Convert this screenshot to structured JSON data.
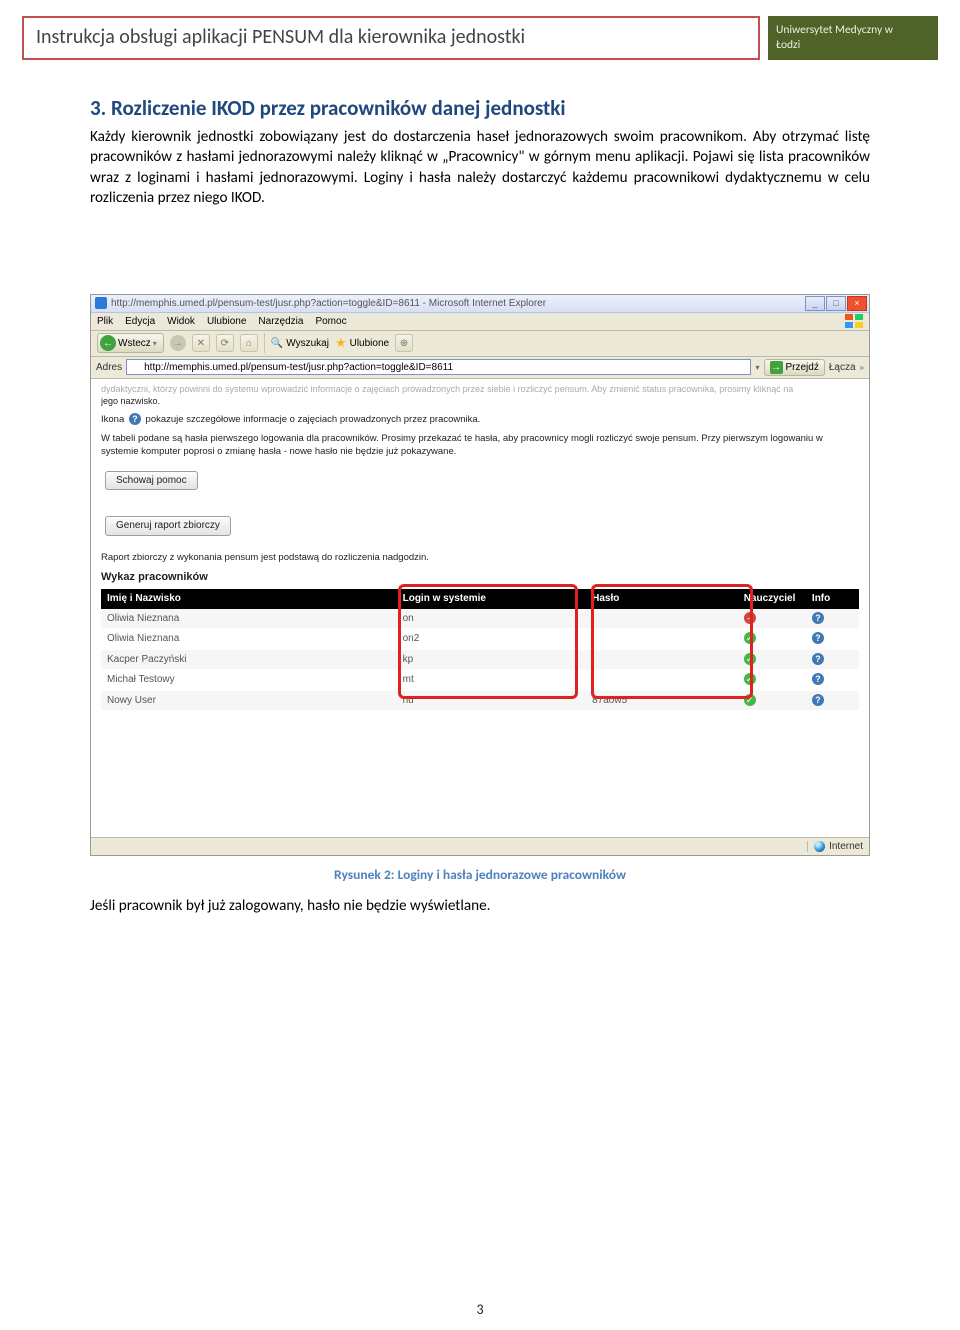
{
  "header": {
    "title": "Instrukcja obsługi aplikacji PENSUM dla kierownika jednostki",
    "uni_line1": "Uniwersytet Medyczny w",
    "uni_line2": "Łodzi"
  },
  "section": {
    "heading": "3. Rozliczenie IKOD przez pracowników danej jednostki",
    "paragraph": "Każdy kierownik jednostki zobowiązany jest do dostarczenia haseł jednorazowych swoim pracownikom. Aby otrzymać listę pracowników z hasłami jednorazowymi należy kliknąć w „Pracownicy\" w górnym menu aplikacji. Pojawi się lista pracowników wraz z loginami i hasłami jednorazowymi. Loginy i hasła należy dostarczyć każdemu pracownikowi dydaktycznemu w celu rozliczenia przez niego IKOD."
  },
  "browser": {
    "window_title": "http://memphis.umed.pl/pensum-test/jusr.php?action=toggle&ID=8611 - Microsoft Internet Explorer",
    "menu": [
      "Plik",
      "Edycja",
      "Widok",
      "Ulubione",
      "Narzędzia",
      "Pomoc"
    ],
    "back_label": "Wstecz",
    "search_label": "Wyszukaj",
    "fav_label": "Ulubione",
    "addr_label": "Adres",
    "url": "http://memphis.umed.pl/pensum-test/jusr.php?action=toggle&ID=8611",
    "go_label": "Przejdź",
    "links_label": "Łącza",
    "status_right": "Internet"
  },
  "page": {
    "cut_text": "dydaktyczni, którzy powinni do systemu wprowadzić informacje o zajęciach prowadzonych przez siebie i rozliczyć pensum. Aby zmienić status pracownika, prosimy kliknąć na",
    "cut_text2": "jego nazwisko.",
    "ikona_text_a": "Ikona ",
    "ikona_text_b": " pokazuje szczegółowe informacje o zajęciach prowadzonych przez pracownika.",
    "para2": "W tabeli podane są hasła pierwszego logowania dla pracowników. Prosimy przekazać te hasła, aby pracownicy mogli rozliczyć swoje pensum. Przy pierwszym logowaniu w systemie komputer poprosi o zmianę hasła - nowe hasło nie będzie już pokazywane.",
    "btn_hide": "Schowaj pomoc",
    "btn_report": "Generuj raport zbiorczy",
    "report_note": "Raport zbiorczy z wykonania pensum jest podstawą do rozliczenia nadgodzin.",
    "wykaz": "Wykaz pracowników",
    "cols": {
      "name": "Imię i Nazwisko",
      "login": "Login w systemie",
      "pass": "Hasło",
      "teacher": "Nauczyciel",
      "info": "Info"
    },
    "rows": [
      {
        "name": "Oliwia Nieznana",
        "login": "on",
        "pass": "",
        "teacher": "red"
      },
      {
        "name": "Oliwia Nieznana",
        "login": "on2",
        "pass": "",
        "teacher": "green"
      },
      {
        "name": "Kacper Paczyński",
        "login": "kp",
        "pass": "",
        "teacher": "green"
      },
      {
        "name": "Michał Testowy",
        "login": "mt",
        "pass": "",
        "teacher": "green"
      },
      {
        "name": "Nowy User",
        "login": "nu",
        "pass": "87aow5",
        "teacher": "green"
      }
    ]
  },
  "caption": "Rysunek 2: Loginy i hasła jednorazowe pracowników",
  "after": "Jeśli pracownik był już zalogowany, hasło nie będzie wyświetlane.",
  "page_number": "3"
}
